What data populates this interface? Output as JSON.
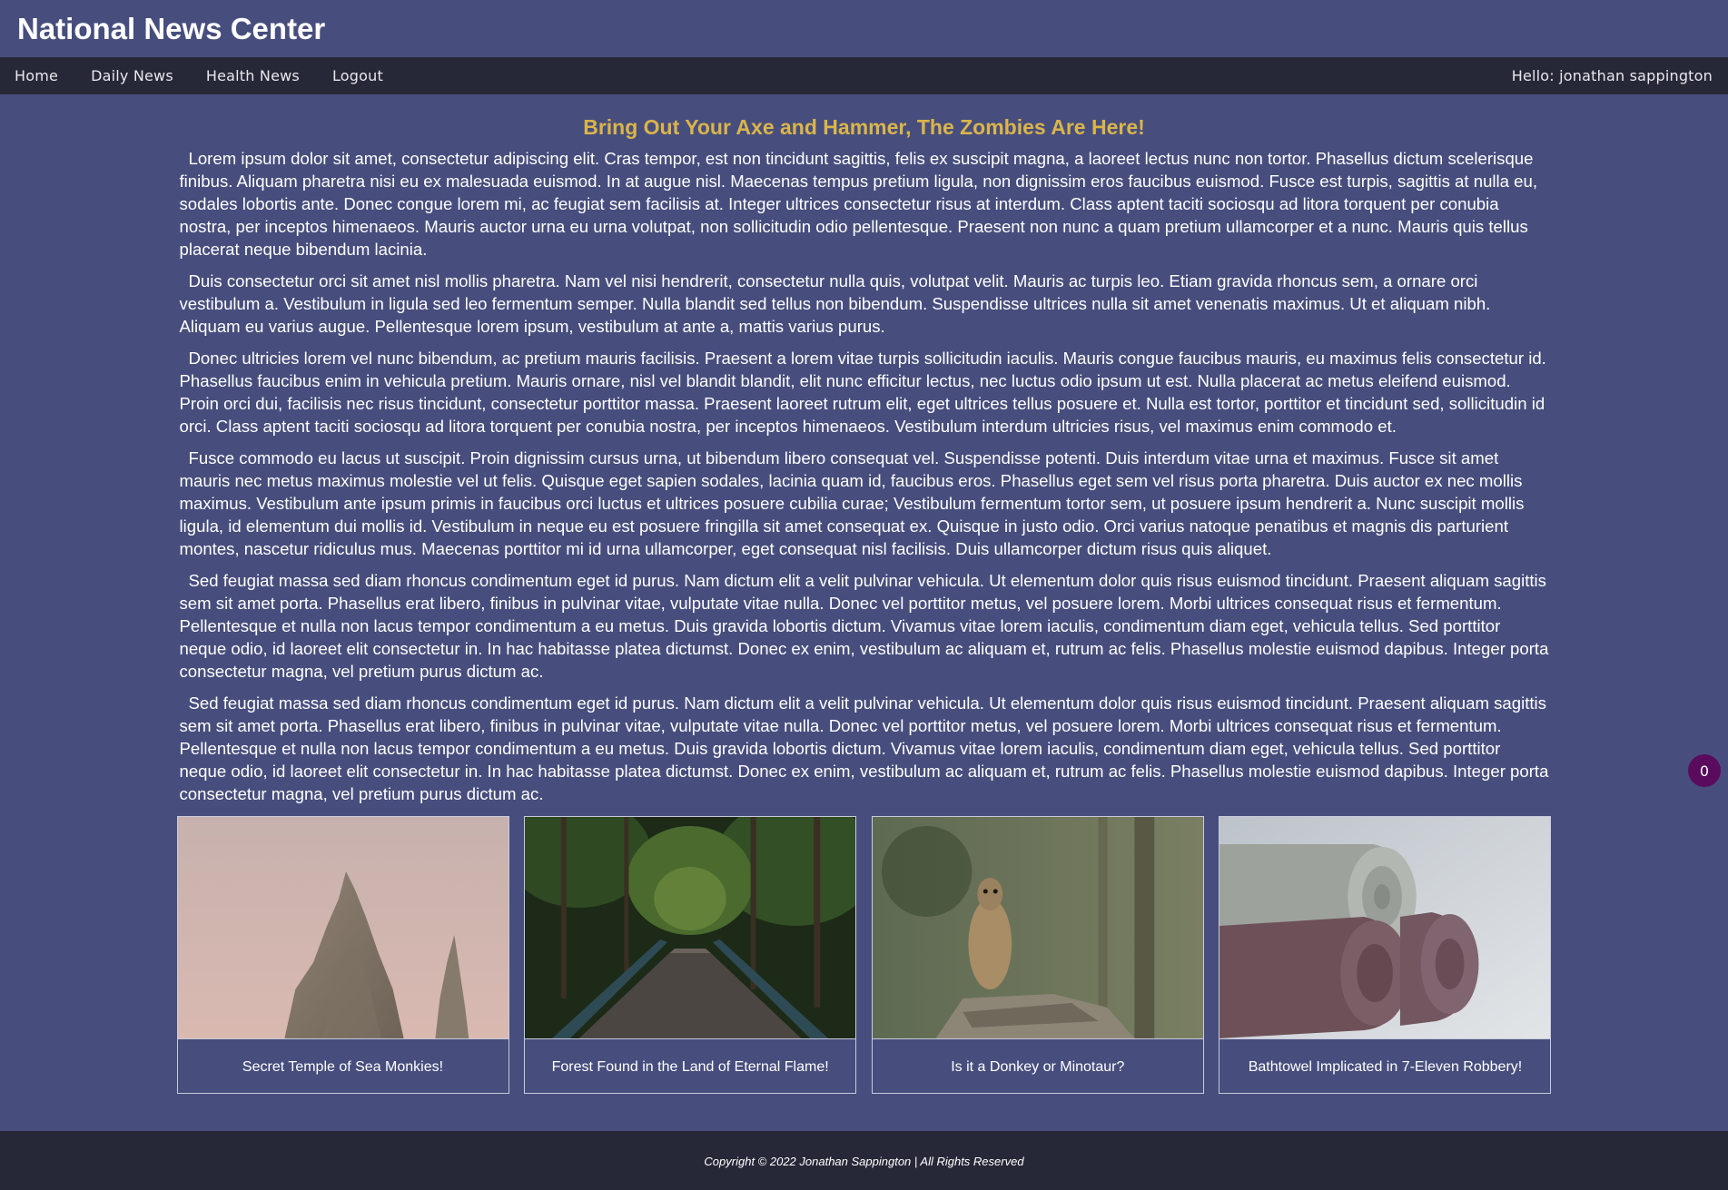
{
  "header": {
    "title": "National News Center"
  },
  "nav": {
    "items": [
      {
        "label": "Home"
      },
      {
        "label": "Daily News"
      },
      {
        "label": "Health News"
      },
      {
        "label": "Logout"
      }
    ],
    "greeting": "Hello: jonathan sappington"
  },
  "article": {
    "title": "Bring Out Your Axe and Hammer, The Zombies Are Here!",
    "paragraphs": [
      "Lorem ipsum dolor sit amet, consectetur adipiscing elit. Cras tempor, est non tincidunt sagittis, felis ex suscipit magna, a laoreet lectus nunc non tortor. Phasellus dictum scelerisque finibus. Aliquam pharetra nisi eu ex malesuada euismod. In at augue nisl. Maecenas tempus pretium ligula, non dignissim eros faucibus euismod. Fusce est turpis, sagittis at nulla eu, sodales lobortis ante. Donec congue lorem mi, ac feugiat sem facilisis at. Integer ultrices consectetur risus at interdum. Class aptent taciti sociosqu ad litora torquent per conubia nostra, per inceptos himenaeos. Mauris auctor urna eu urna volutpat, non sollicitudin odio pellentesque. Praesent non nunc a quam pretium ullamcorper et a nunc. Mauris quis tellus placerat neque bibendum lacinia.",
      "Duis consectetur orci sit amet nisl mollis pharetra. Nam vel nisi hendrerit, consectetur nulla quis, volutpat velit. Mauris ac turpis leo. Etiam gravida rhoncus sem, a ornare orci vestibulum a. Vestibulum in ligula sed leo fermentum semper. Nulla blandit sed tellus non bibendum. Suspendisse ultrices nulla sit amet venenatis maximus. Ut et aliquam nibh. Aliquam eu varius augue. Pellentesque lorem ipsum, vestibulum at ante a, mattis varius purus.",
      "Donec ultricies lorem vel nunc bibendum, ac pretium mauris facilisis. Praesent a lorem vitae turpis sollicitudin iaculis. Mauris congue faucibus mauris, eu maximus felis consectetur id. Phasellus faucibus enim in vehicula pretium. Mauris ornare, nisl vel blandit blandit, elit nunc efficitur lectus, nec luctus odio ipsum ut est. Nulla placerat ac metus eleifend euismod. Proin orci dui, facilisis nec risus tincidunt, consectetur porttitor massa. Praesent laoreet rutrum elit, eget ultrices tellus posuere et. Nulla est tortor, porttitor et tincidunt sed, sollicitudin id orci. Class aptent taciti sociosqu ad litora torquent per conubia nostra, per inceptos himenaeos. Vestibulum interdum ultricies risus, vel maximus enim commodo et.",
      "Fusce commodo eu lacus ut suscipit. Proin dignissim cursus urna, ut bibendum libero consequat vel. Suspendisse potenti. Duis interdum vitae urna et maximus. Fusce sit amet mauris nec metus maximus molestie vel ut felis. Quisque eget sapien sodales, lacinia quam id, faucibus eros. Phasellus eget sem vel risus porta pharetra. Duis auctor ex nec mollis maximus. Vestibulum ante ipsum primis in faucibus orci luctus et ultrices posuere cubilia curae; Vestibulum fermentum tortor sem, ut posuere ipsum hendrerit a. Nunc suscipit mollis ligula, id elementum dui mollis id. Vestibulum in neque eu est posuere fringilla sit amet consequat ex. Quisque in justo odio. Orci varius natoque penatibus et magnis dis parturient montes, nascetur ridiculus mus. Maecenas porttitor mi id urna ullamcorper, eget consequat nisl facilisis. Duis ullamcorper dictum risus quis aliquet.",
      "Sed feugiat massa sed diam rhoncus condimentum eget id purus. Nam dictum elit a velit pulvinar vehicula. Ut elementum dolor quis risus euismod tincidunt. Praesent aliquam sagittis sem sit amet porta. Phasellus erat libero, finibus in pulvinar vitae, vulputate vitae nulla. Donec vel porttitor metus, vel posuere lorem. Morbi ultrices consequat risus et fermentum. Pellentesque et nulla non lacus tempor condimentum a eu metus. Duis gravida lobortis dictum. Vivamus vitae lorem iaculis, condimentum diam eget, vehicula tellus. Sed porttitor neque odio, id laoreet elit consectetur in. In hac habitasse platea dictumst. Donec ex enim, vestibulum ac aliquam et, rutrum ac felis. Phasellus molestie euismod dapibus. Integer porta consectetur magna, vel pretium purus dictum ac.",
      "Sed feugiat massa sed diam rhoncus condimentum eget id purus. Nam dictum elit a velit pulvinar vehicula. Ut elementum dolor quis risus euismod tincidunt. Praesent aliquam sagittis sem sit amet porta. Phasellus erat libero, finibus in pulvinar vitae, vulputate vitae nulla. Donec vel porttitor metus, vel posuere lorem. Morbi ultrices consequat risus et fermentum. Pellentesque et nulla non lacus tempor condimentum a eu metus. Duis gravida lobortis dictum. Vivamus vitae lorem iaculis, condimentum diam eget, vehicula tellus. Sed porttitor neque odio, id laoreet elit consectetur in. In hac habitasse platea dictumst. Donec ex enim, vestibulum ac aliquam et, rutrum ac felis. Phasellus molestie euismod dapibus. Integer porta consectetur magna, vel pretium purus dictum ac."
    ]
  },
  "cards": [
    {
      "caption": "Secret Temple of Sea Monkies!",
      "image": "rock-spire-photo"
    },
    {
      "caption": "Forest Found in the Land of Eternal Flame!",
      "image": "forest-bridge-photo"
    },
    {
      "caption": "Is it a Donkey or Minotaur?",
      "image": "meerkat-photo"
    },
    {
      "caption": "Bathtowel Implicated in 7-Eleven Robbery!",
      "image": "rolled-towels-photo"
    }
  ],
  "footer": {
    "copyright": "Copyright © 2022 Jonathan Sappington | All Rights Reserved"
  },
  "badge": {
    "count": "0"
  },
  "colors": {
    "background": "#474e7d",
    "navbar": "#262838",
    "title_accent": "#dbb54a",
    "badge": "#5a0b5e"
  }
}
